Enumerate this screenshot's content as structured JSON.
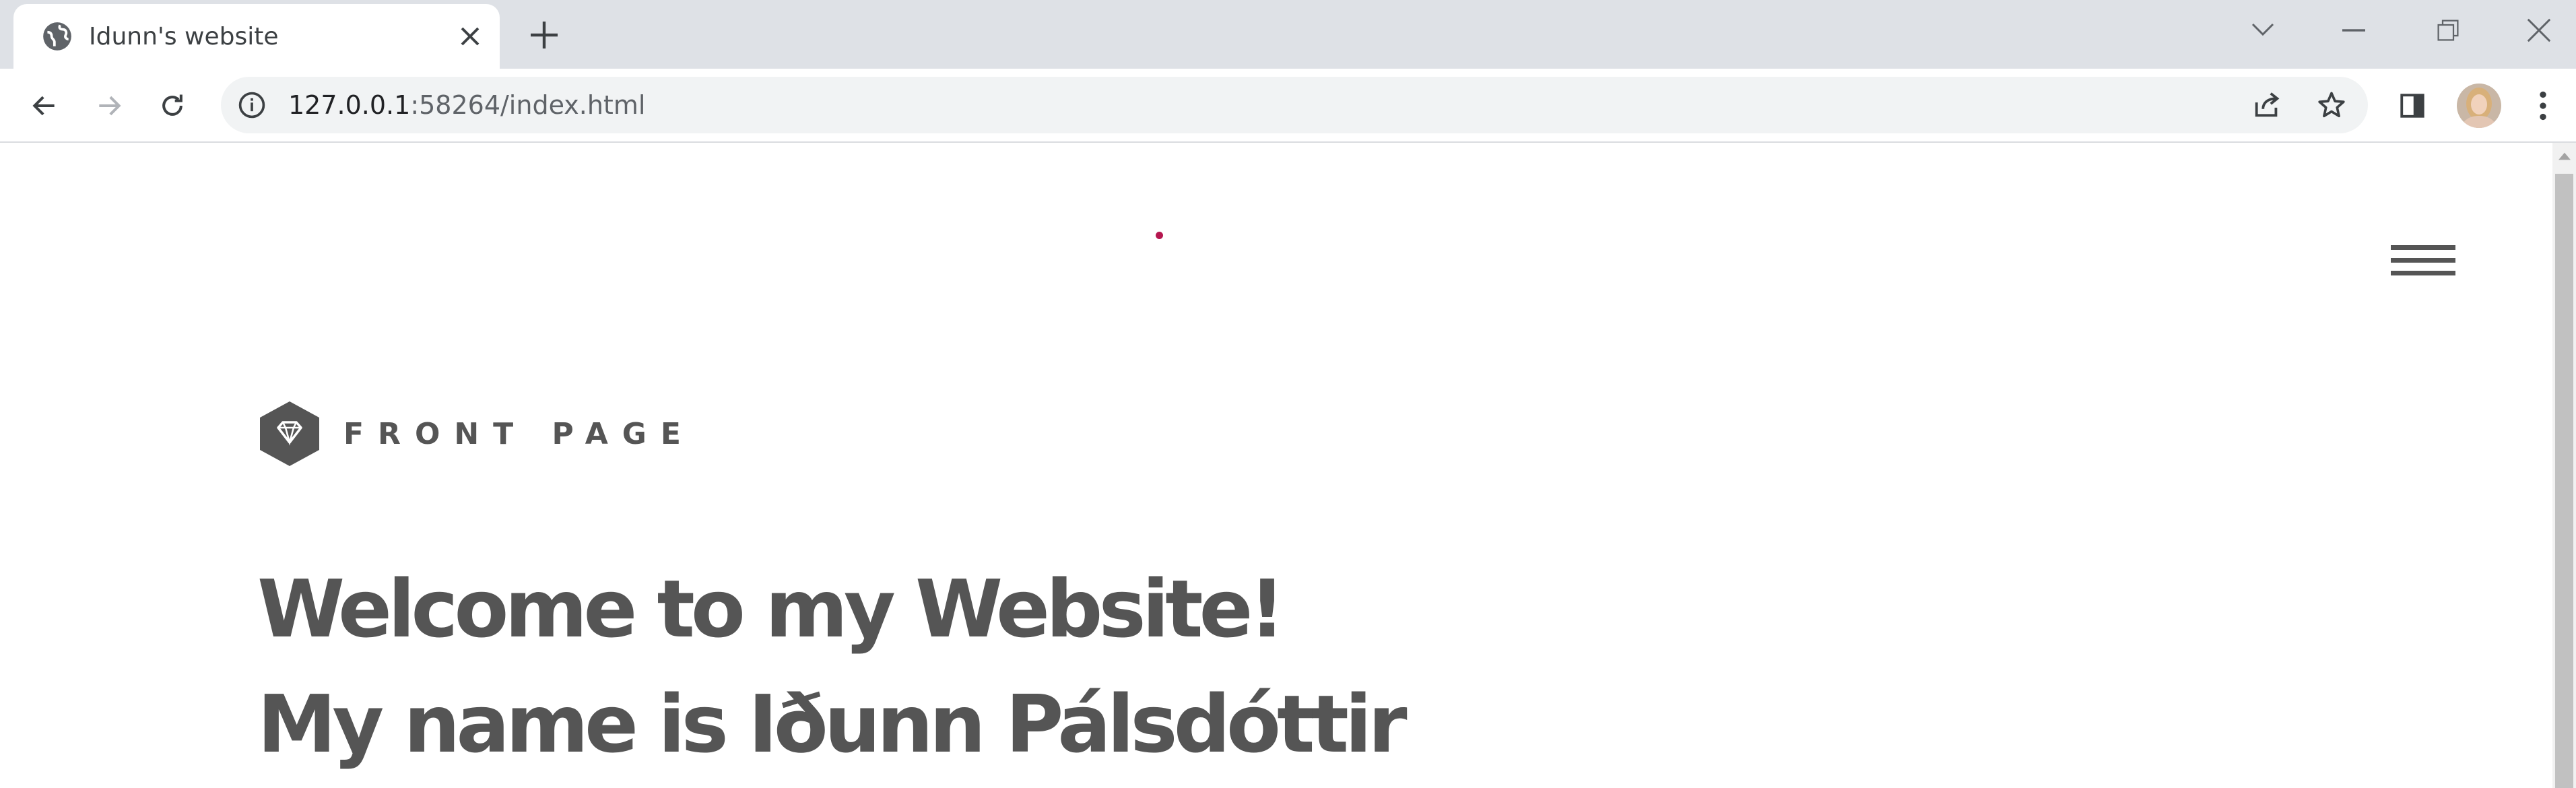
{
  "browser": {
    "tab": {
      "title": "Idunn's website",
      "favicon": "globe-icon"
    },
    "new_tab_icon": "plus-icon",
    "window_controls": [
      "chevron-down-icon",
      "minimize-icon",
      "restore-icon",
      "close-icon"
    ],
    "address_bar": {
      "host": "127.0.0.1",
      "rest": ":58264/index.html",
      "info_icon": "info-icon",
      "share_icon": "share-icon",
      "bookmark_icon": "star-icon"
    },
    "nav_icons": [
      "back-arrow-icon",
      "forward-arrow-icon",
      "reload-icon"
    ],
    "toolbar_icons": [
      "side-panel-icon",
      "avatar",
      "kebab-menu-icon"
    ]
  },
  "page": {
    "menu_icon": "hamburger-menu-icon",
    "section": {
      "icon": "diamond-icon",
      "label": "FRONT PAGE"
    },
    "headline": {
      "line1": "Welcome to my Website!",
      "line2": "My name is Iðunn Pálsdóttir"
    }
  },
  "colors": {
    "tabstrip": "#dee1e6",
    "text_dark": "#555555",
    "accent_dot": "#b5174f"
  }
}
